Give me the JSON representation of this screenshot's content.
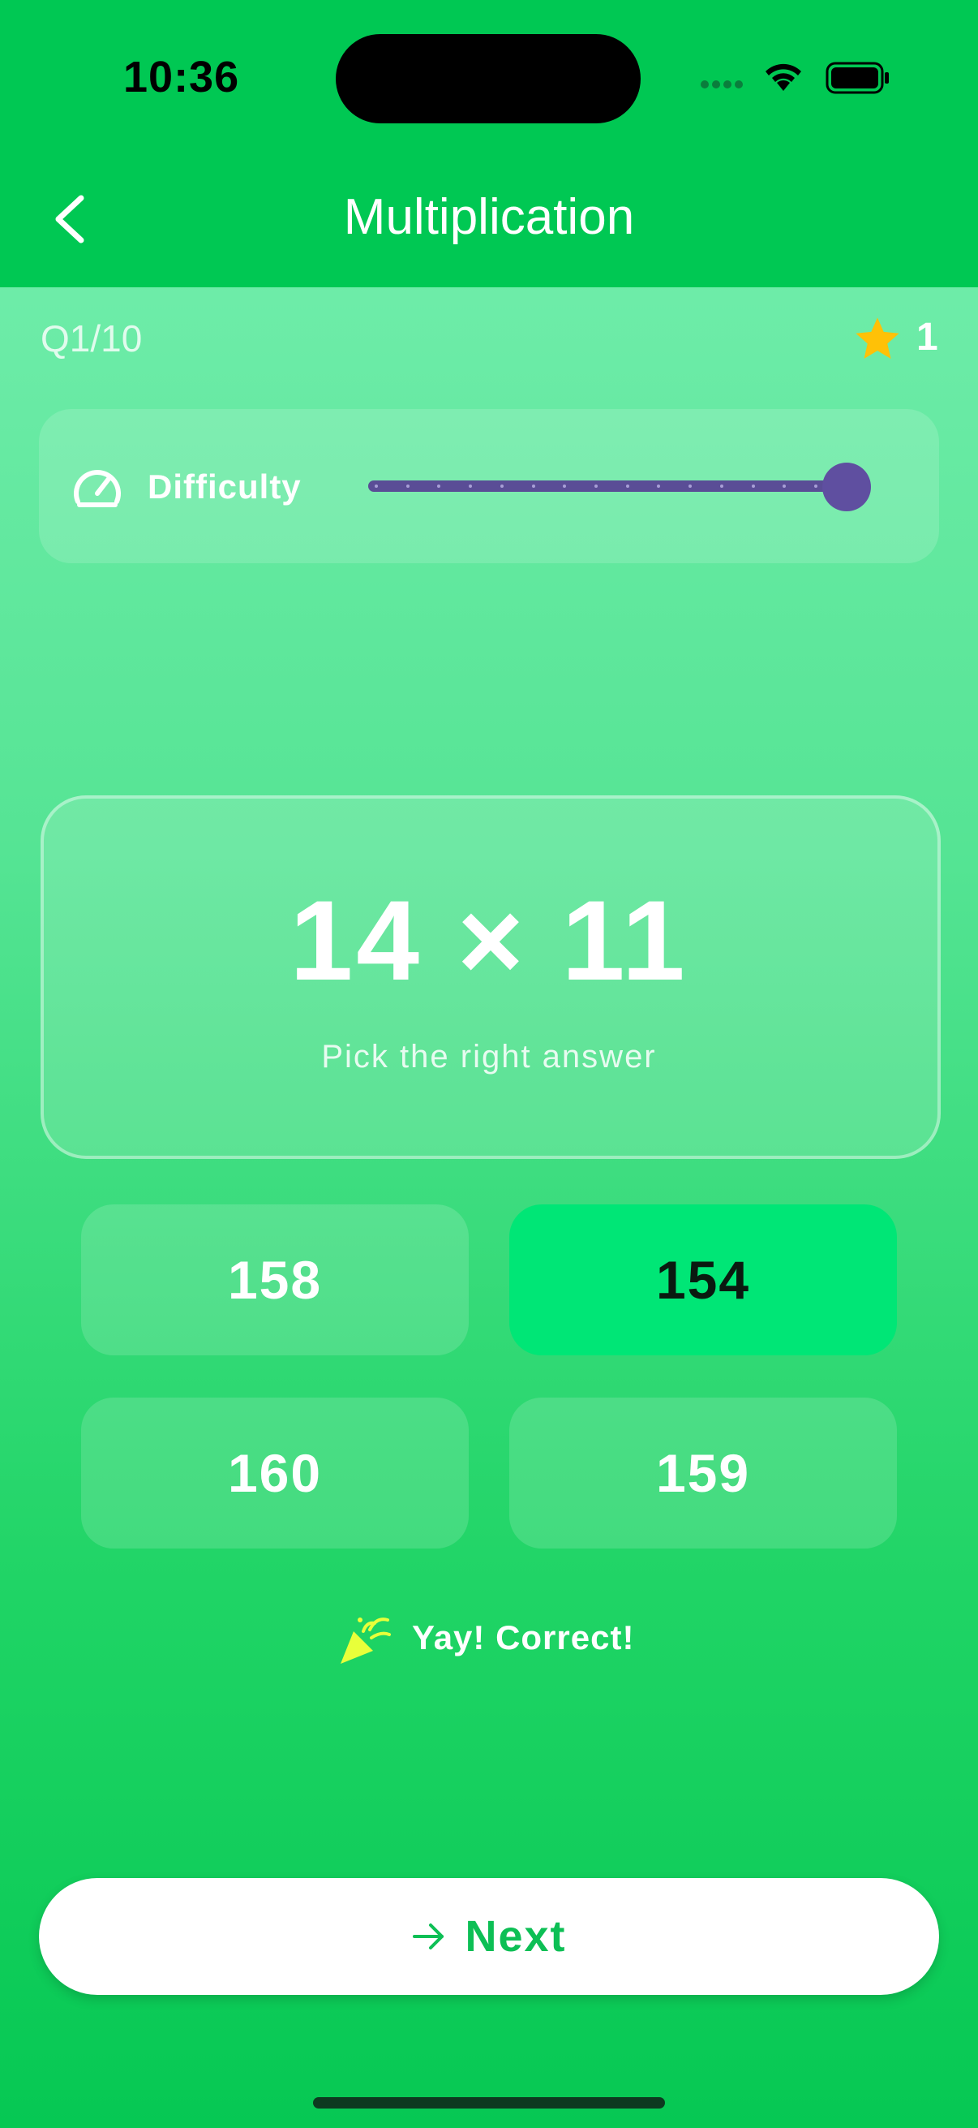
{
  "status_bar": {
    "time": "10:36"
  },
  "nav": {
    "title": "Multiplication"
  },
  "progress": {
    "question_counter": "Q1/10",
    "star_count": "1"
  },
  "difficulty": {
    "label": "Difficulty",
    "level_fraction": 1.0,
    "steps": 15
  },
  "question": {
    "expression": "14 × 11",
    "hint": "Pick the right answer"
  },
  "options": [
    {
      "label": "158",
      "state": "default"
    },
    {
      "label": "154",
      "state": "correct"
    },
    {
      "label": "160",
      "state": "default"
    },
    {
      "label": "159",
      "state": "default"
    }
  ],
  "feedback": {
    "text": "Yay! Correct!",
    "icon": "party-popper-icon"
  },
  "next_button": {
    "label": "Next",
    "icon": "arrow-right-icon"
  },
  "colors": {
    "accent": "#00c853",
    "correct": "#00e676",
    "slider": "#5f4fa0",
    "star": "#ffc107",
    "next_text": "#0dbf55"
  }
}
